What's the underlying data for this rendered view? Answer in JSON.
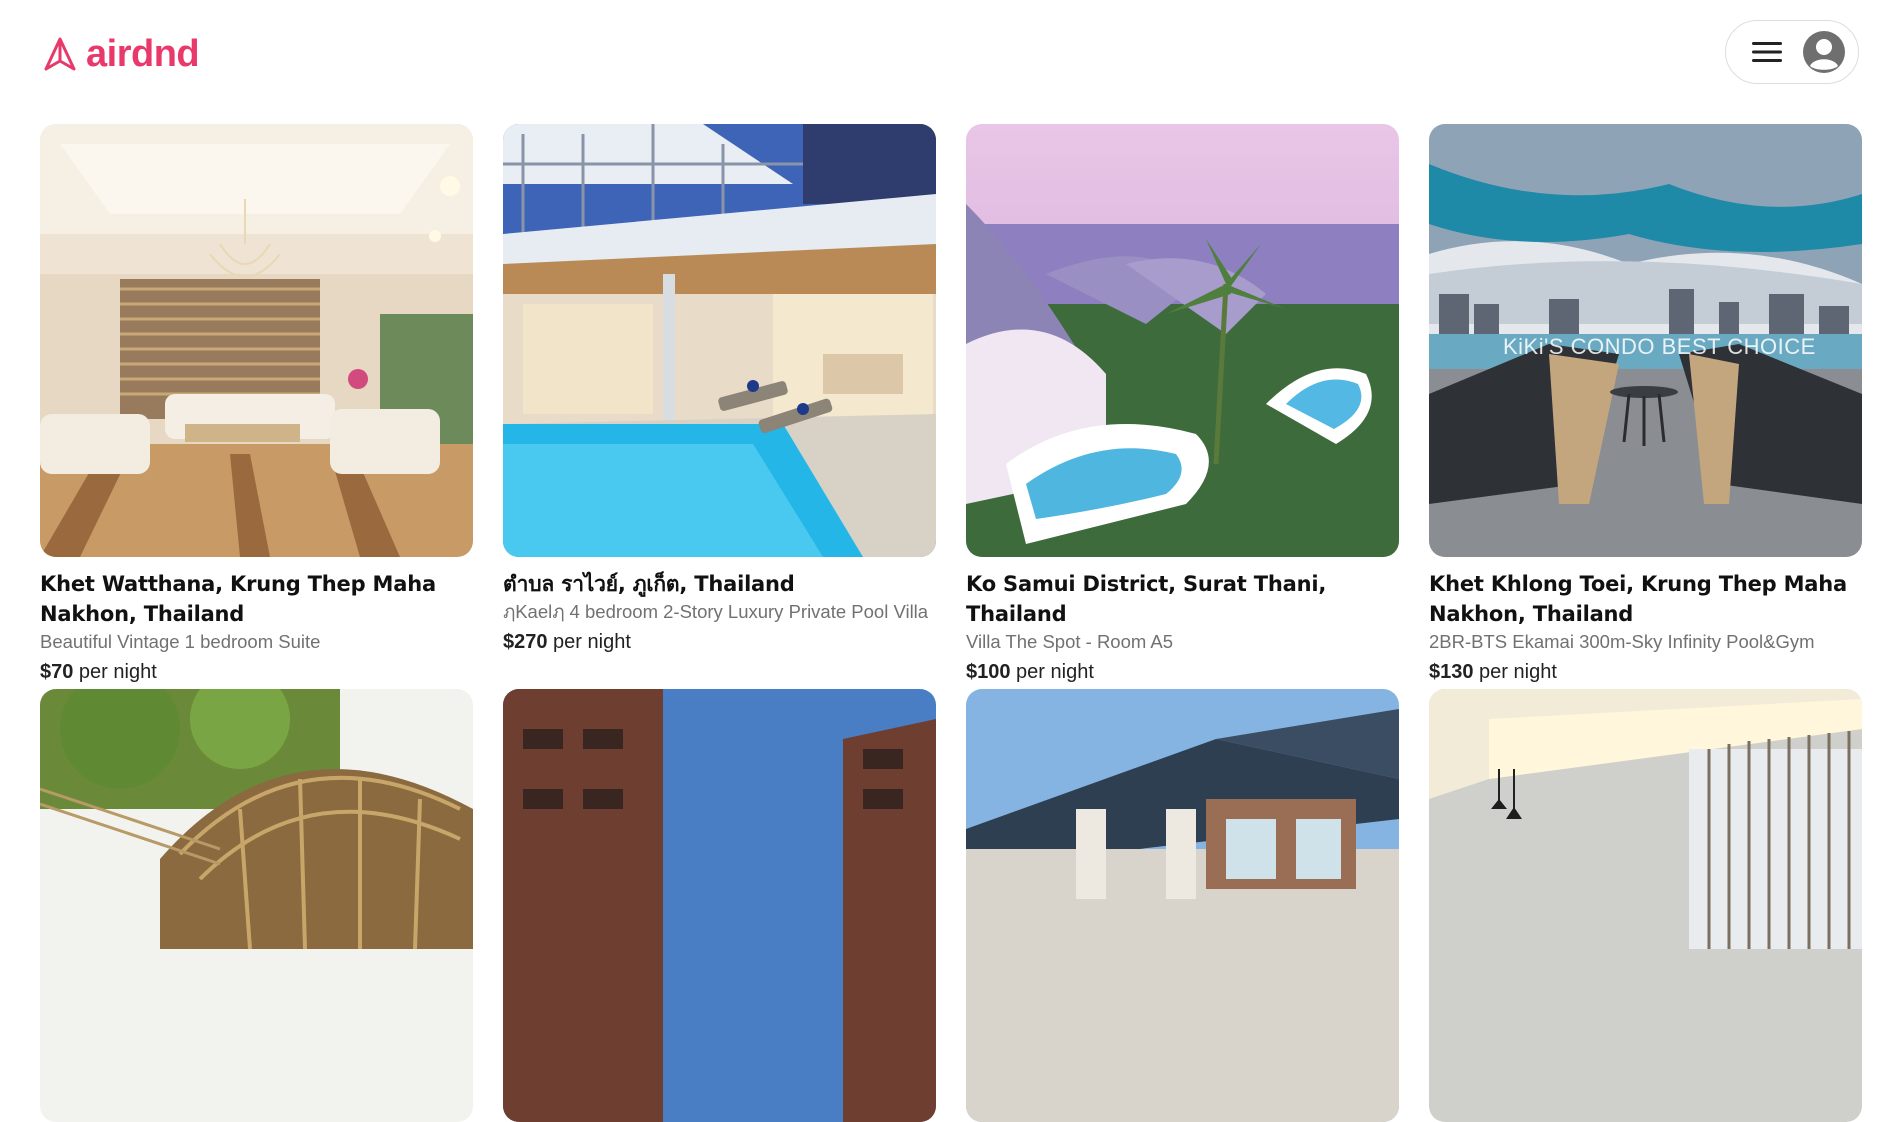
{
  "app": {
    "name": "airdnd",
    "brand_color": "#e8396a"
  },
  "header": {
    "logo_icon": "paper-plane-icon",
    "menu_icon": "hamburger-menu-icon",
    "avatar_icon": "user-avatar-icon"
  },
  "listings": [
    {
      "location": "Khet Watthana, Krung Thep Maha Nakhon, Thailand",
      "title": "Beautiful Vintage 1 bedroom Suite",
      "price": "$70",
      "price_suffix": " per night",
      "photo": "luxury lobby with chandelier and white sofas"
    },
    {
      "location": "ตำบล ราไวย์, ภูเก็ต, Thailand",
      "title": "ฦKaelฦ 4 bedroom 2-Story Luxury Private Pool Villa",
      "price": "$270",
      "price_suffix": " per night",
      "photo": "villa with private pool at dusk"
    },
    {
      "location": "Ko Samui District, Surat Thani, Thailand",
      "title": "Villa The Spot - Room A5",
      "price": "$100",
      "price_suffix": " per night",
      "photo": "curved white villas with infinity pools overlooking sea"
    },
    {
      "location": "Khet Khlong Toei, Krung Thep Maha Nakhon, Thailand",
      "title": "2BR-BTS Ekamai 300m-Sky Infinity Pool&Gym",
      "price": "$130",
      "price_suffix": " per night",
      "photo": "rooftop infinity pool with sun loungers and city skyline",
      "watermark": "KiKi'S  CONDO BEST CHOICE"
    },
    {
      "photo": "bamboo dome house among trees"
    },
    {
      "photo": "brick apartment buildings at dusk"
    },
    {
      "photo": "house with tiled roof"
    },
    {
      "photo": "modern interior with pendant lights"
    }
  ]
}
